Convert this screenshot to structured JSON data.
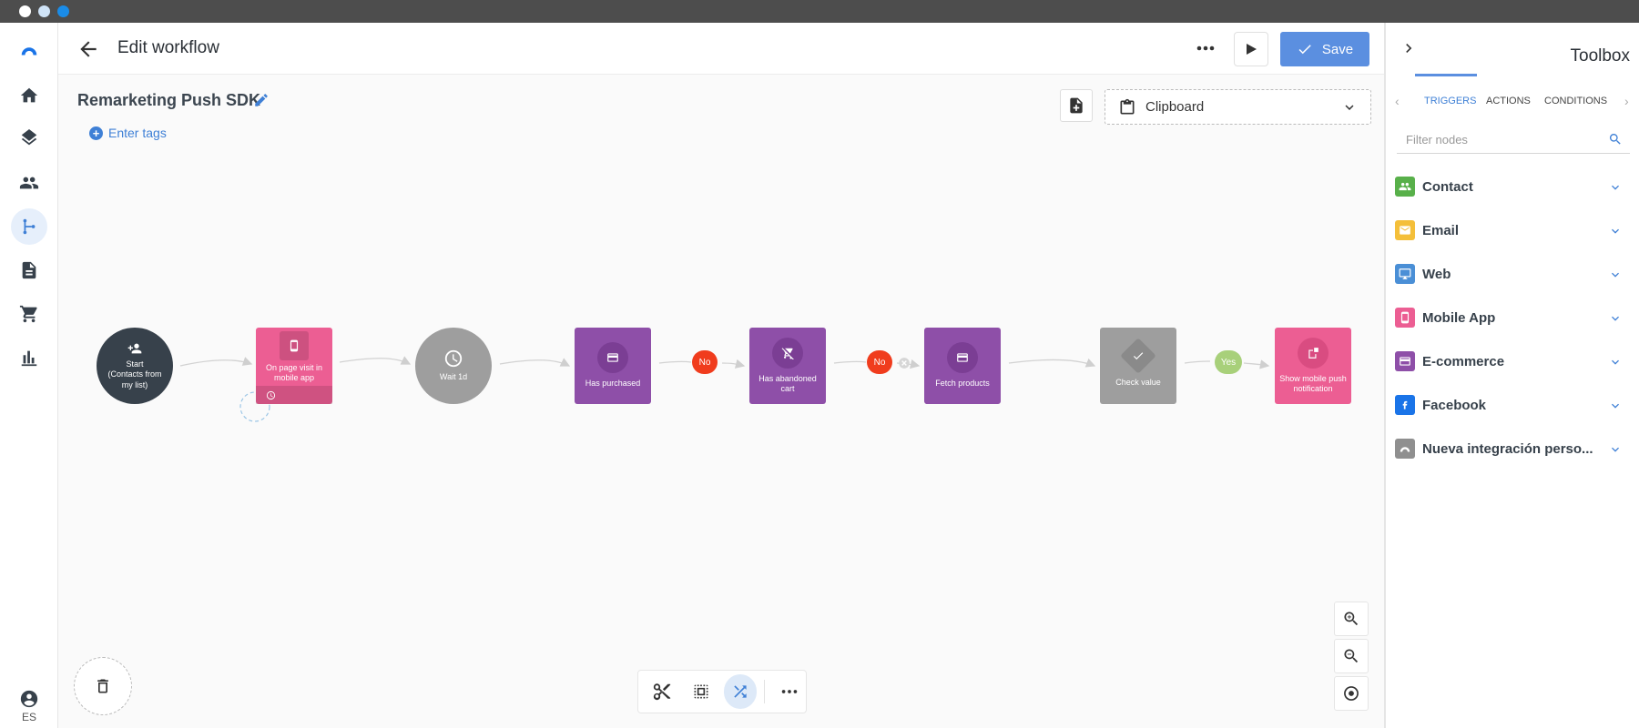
{
  "window": {
    "dots": [
      {
        "name": "close-dot",
        "color": "#ffffff"
      },
      {
        "name": "minimize-dot",
        "color": "#cfe3f7"
      },
      {
        "name": "maximize-dot",
        "color": "#1a8ce8"
      }
    ]
  },
  "rail": {
    "items": [
      {
        "name": "logo-icon"
      },
      {
        "name": "home-icon"
      },
      {
        "name": "layers-icon"
      },
      {
        "name": "contacts-icon"
      },
      {
        "name": "workflow-icon",
        "active": true
      },
      {
        "name": "document-icon"
      },
      {
        "name": "cart-icon"
      },
      {
        "name": "stats-icon"
      }
    ],
    "language": "ES"
  },
  "header": {
    "title": "Edit workflow",
    "save_label": "Save"
  },
  "canvas": {
    "workflow_name": "Remarketing Push SDK",
    "tags_label": "Enter tags",
    "clipboard_label": "Clipboard",
    "nodes": [
      {
        "id": "start",
        "label": "Start\n(Contacts from my list)",
        "color": "#37414b",
        "icon": "user-add-icon"
      },
      {
        "id": "page-visit",
        "label": "On page visit in mobile app",
        "color": "#ec5e93",
        "icon": "mobile-icon"
      },
      {
        "id": "wait",
        "label": "Wait 1d",
        "color": "#9e9e9e",
        "icon": "clock-icon"
      },
      {
        "id": "has-purchased",
        "label": "Has purchased",
        "color": "#8e4fa8",
        "icon": "card-icon"
      },
      {
        "id": "abandoned-cart",
        "label": "Has abandoned cart",
        "color": "#8e4fa8",
        "icon": "cart-off-icon"
      },
      {
        "id": "fetch-products",
        "label": "Fetch products",
        "color": "#8e4fa8",
        "icon": "card-icon"
      },
      {
        "id": "check-value",
        "label": "Check value",
        "color": "#9e9e9e",
        "icon": "check-icon"
      },
      {
        "id": "push-notification",
        "label": "Show mobile push notification",
        "color": "#ec5e93",
        "icon": "push-icon"
      }
    ],
    "branches": [
      {
        "label": "No",
        "color": "#f03c1d"
      },
      {
        "label": "No",
        "color": "#f03c1d"
      },
      {
        "label": "Yes",
        "color": "#a8d07a"
      }
    ]
  },
  "toolbox": {
    "title": "Toolbox",
    "tabs": [
      {
        "label": "TRIGGERS",
        "active": true
      },
      {
        "label": "ACTIONS"
      },
      {
        "label": "CONDITIONS"
      }
    ],
    "filter_placeholder": "Filter nodes",
    "categories": [
      {
        "label": "Contact",
        "color": "#58b04a",
        "icon": "contacts-icon"
      },
      {
        "label": "Email",
        "color": "#f4bf3a",
        "icon": "email-icon"
      },
      {
        "label": "Web",
        "color": "#4a8fd6",
        "icon": "monitor-icon"
      },
      {
        "label": "Mobile App",
        "color": "#ec5e93",
        "icon": "mobile-icon"
      },
      {
        "label": "E-commerce",
        "color": "#8e4fa8",
        "icon": "card-icon"
      },
      {
        "label": "Facebook",
        "color": "#1a74e8",
        "icon": "facebook-icon"
      },
      {
        "label": "Nueva integración perso...",
        "color": "#8f8f8f",
        "icon": "integration-icon"
      }
    ]
  },
  "colors": {
    "accent": "#5b8fe0",
    "link": "#3f80d6"
  }
}
